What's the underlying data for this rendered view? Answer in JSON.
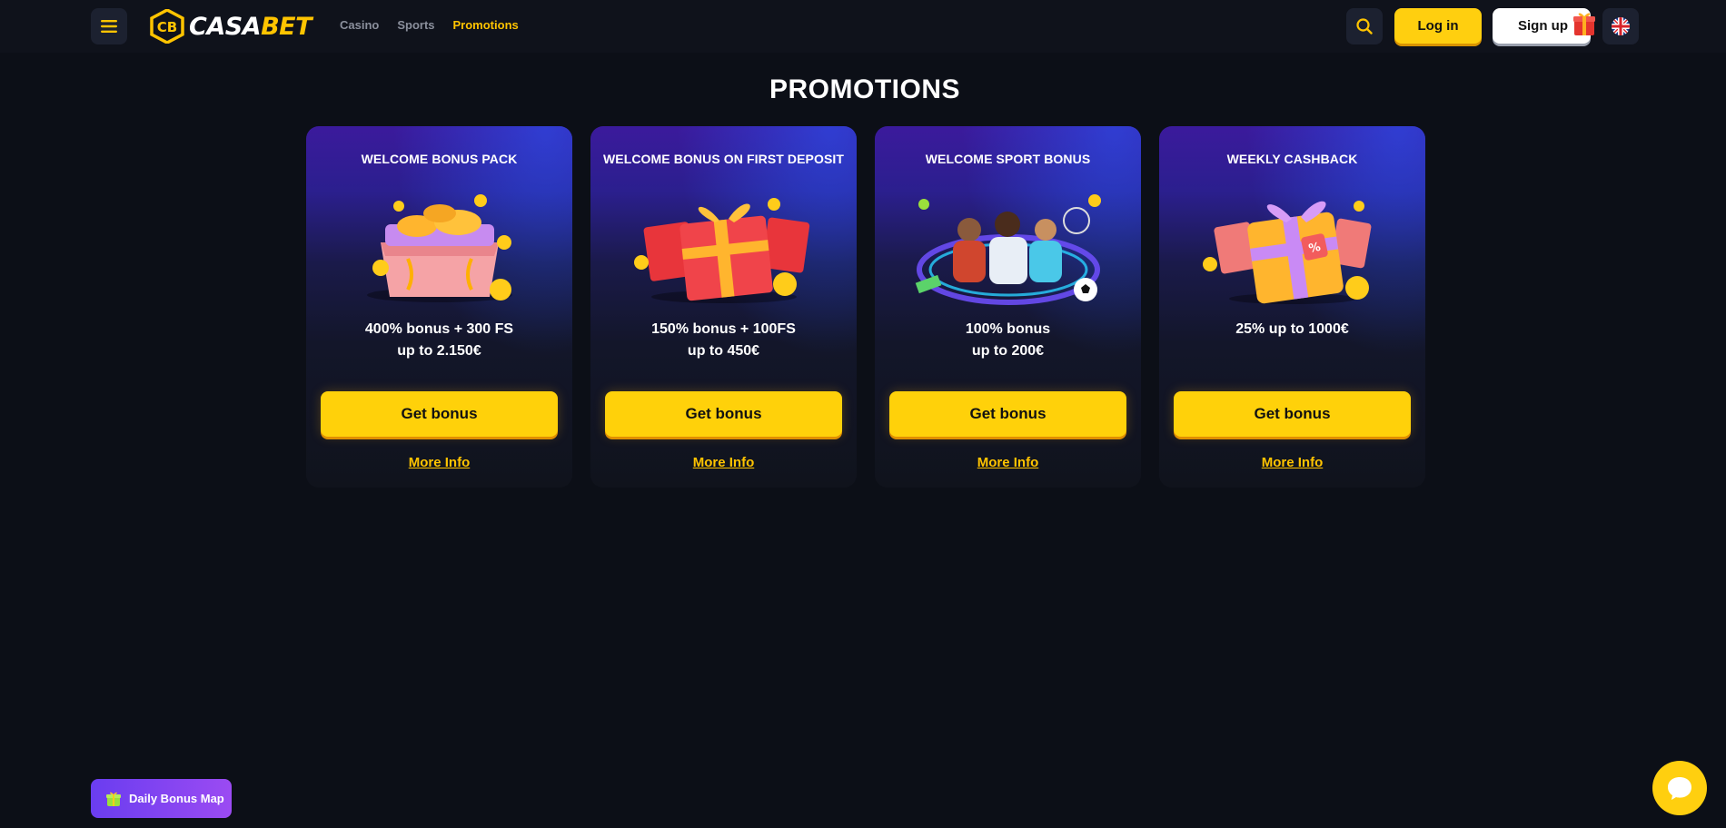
{
  "header": {
    "menu_icon": "hamburger-icon",
    "logo": {
      "text_casa": "CASA",
      "text_bet": "BET",
      "mark": "CB"
    },
    "nav": [
      {
        "label": "Casino",
        "active": false
      },
      {
        "label": "Sports",
        "active": false
      },
      {
        "label": "Promotions",
        "active": true
      }
    ],
    "search_icon": "search-icon",
    "login_label": "Log in",
    "signup_label": "Sign up",
    "language_icon": "uk-flag-icon"
  },
  "page": {
    "title": "PROMOTIONS"
  },
  "promotions": [
    {
      "title": "WELCOME BONUS PACK",
      "line1": "400% bonus + 300 FS",
      "line2": "up to 2.150€",
      "button": "Get bonus",
      "link": "More Info",
      "art": "treasure-chest"
    },
    {
      "title": "WELCOME BONUS ON FIRST DEPOSIT",
      "line1": "150% bonus + 100FS",
      "line2": "up to 450€",
      "button": "Get bonus",
      "link": "More Info",
      "art": "red-gift-boxes"
    },
    {
      "title": "WELCOME SPORT BONUS",
      "line1": "100% bonus",
      "line2": "up to 200€",
      "button": "Get bonus",
      "link": "More Info",
      "art": "sport-players"
    },
    {
      "title": "WEEKLY CASHBACK",
      "line1": "25% up to 1000€",
      "line2": "",
      "button": "Get bonus",
      "link": "More Info",
      "art": "orange-gift-box"
    }
  ],
  "floating": {
    "daily_bonus_label": "Daily Bonus Map",
    "chat_icon": "chat-bubble-icon"
  },
  "colors": {
    "accent": "#ffc400",
    "background": "#0c0f17",
    "button_yellow": "#ffd10a",
    "daily_purple": "#7a43f0"
  }
}
